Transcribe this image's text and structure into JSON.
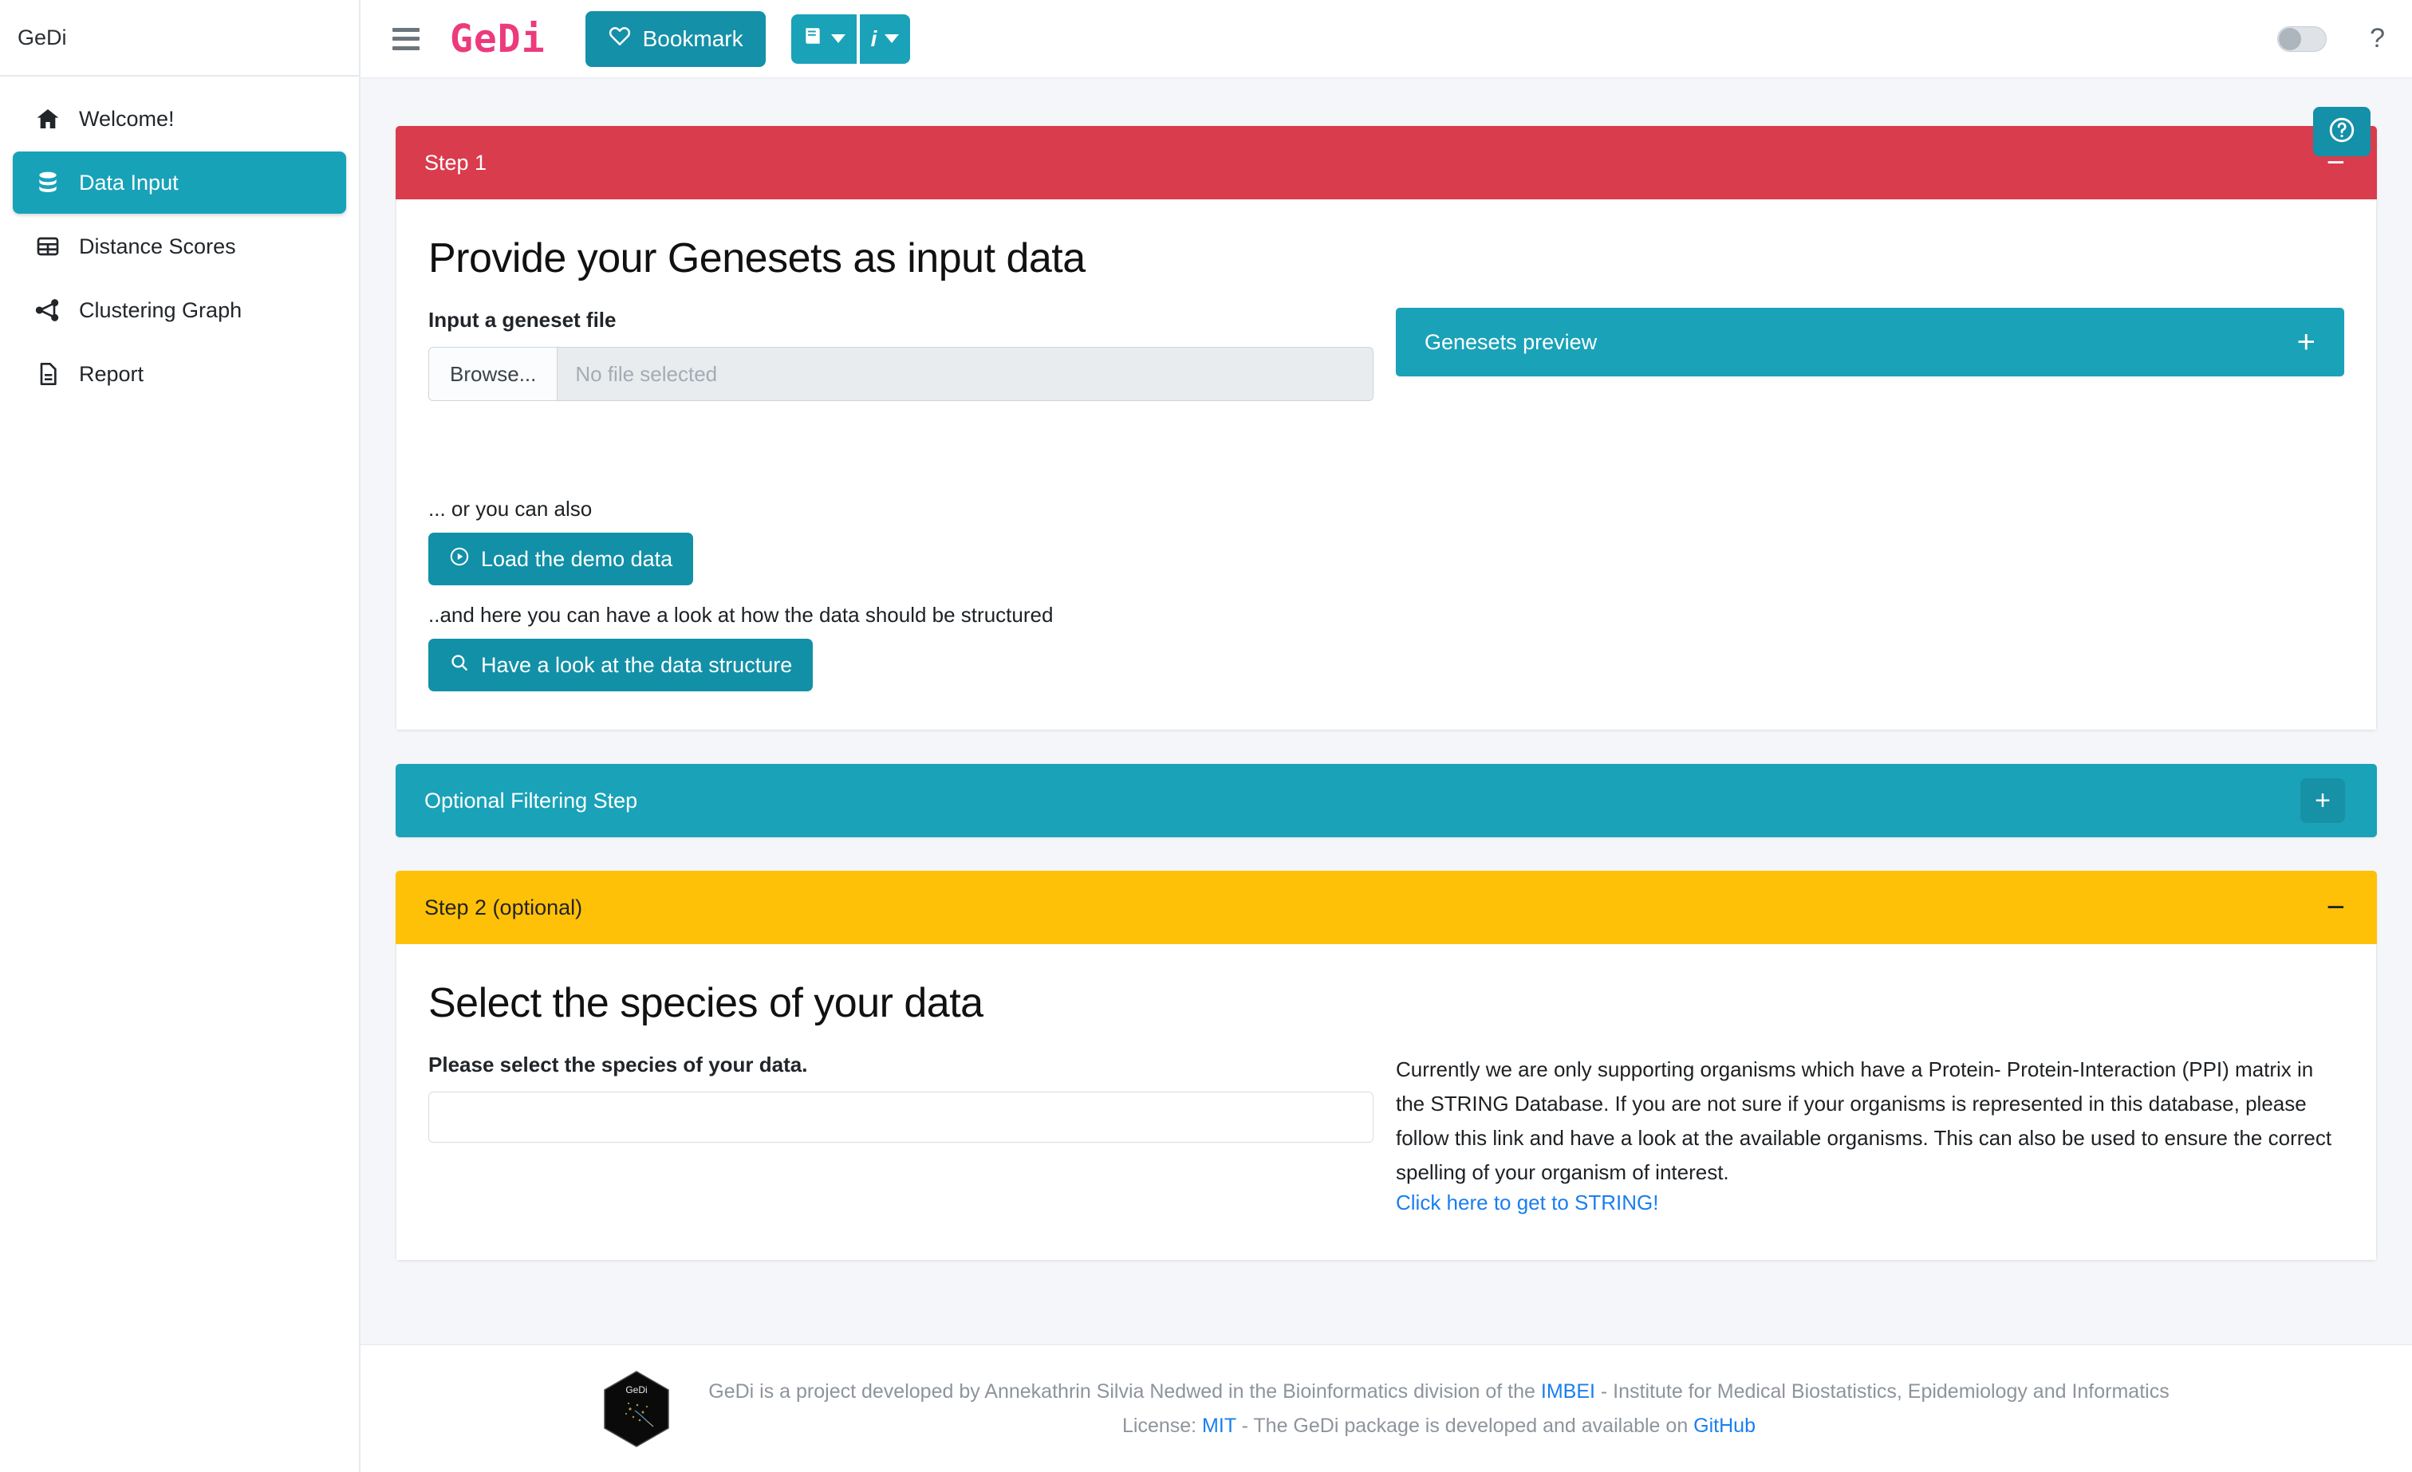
{
  "sidebar": {
    "brand": "GeDi",
    "items": [
      {
        "label": "Welcome!",
        "icon": "home-icon",
        "active": false
      },
      {
        "label": "Data Input",
        "icon": "database-icon",
        "active": true
      },
      {
        "label": "Distance Scores",
        "icon": "table-icon",
        "active": false
      },
      {
        "label": "Clustering Graph",
        "icon": "share-nodes-icon",
        "active": false
      },
      {
        "label": "Report",
        "icon": "file-text-icon",
        "active": false
      }
    ]
  },
  "navbar": {
    "menu_icon": "hamburger-icon",
    "brand": "GeDi",
    "bookmark_label": "Bookmark",
    "bookmark_icon": "heart-icon",
    "book_icon": "book-icon",
    "info_icon": "info-icon",
    "toggle_state": "off",
    "help_glyph": "?"
  },
  "help_tab": {
    "icon": "question-circle-icon"
  },
  "step1": {
    "header": "Step 1",
    "collapse_sign": "−",
    "title": "Provide your Genesets as input data",
    "file_label": "Input a geneset file",
    "browse_label": "Browse...",
    "file_placeholder": "No file selected",
    "or_text": "... or you can also",
    "demo_button": "Load the demo data",
    "demo_icon": "play-circle-icon",
    "structure_text": "..and here you can have a look at how the data should be structured",
    "structure_button": "Have a look at the data structure",
    "structure_icon": "search-icon",
    "preview_title": "Genesets preview",
    "preview_sign": "+"
  },
  "filtering": {
    "header": "Optional Filtering Step",
    "expand_sign": "+"
  },
  "step2": {
    "header": "Step 2 (optional)",
    "collapse_sign": "−",
    "title": "Select the species of your data",
    "select_label": "Please select the species of your data.",
    "select_value": "",
    "description": "Currently we are only supporting organisms which have a Protein- Protein-Interaction (PPI) matrix in the STRING Database. If you are not sure if your organisms is represented in this database, please follow this link and have a look at the available organisms. This can also be used to ensure the correct spelling of your organism of interest.",
    "string_link": "Click here to get to STRING!"
  },
  "footer": {
    "logo_label": "GeDi",
    "line1_a": "GeDi is a project developed by Annekathrin Silvia Nedwed in the Bioinformatics division of the ",
    "line1_link": "IMBEI",
    "line1_b": " - Institute for Medical Biostatistics, Epidemiology and Informatics",
    "line2_a": "License: ",
    "line2_link1": "MIT",
    "line2_b": " - The GeDi package is developed and available on ",
    "line2_link2": "GitHub"
  },
  "colors": {
    "accent_teal": "#1aa2b8",
    "accent_teal_dark": "#1290a7",
    "danger_red": "#d93c4d",
    "warning_amber": "#ffc107",
    "brand_pink": "#ec3a7d",
    "link_blue": "#1a7ef0"
  }
}
